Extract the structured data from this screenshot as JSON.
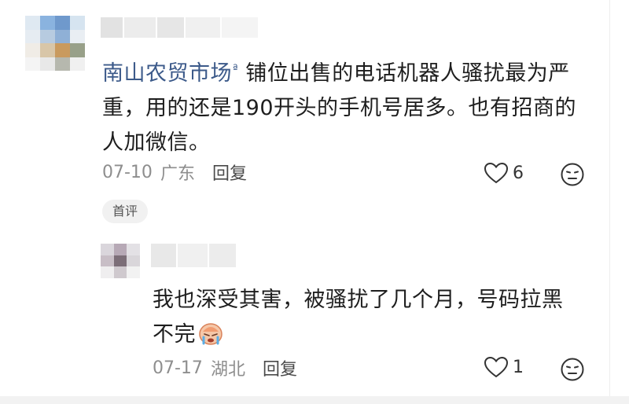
{
  "comments": [
    {
      "mention": "南山农贸市场",
      "mention_mark": "ª",
      "text_line1": " 铺位出售的电话机器人骚扰最为",
      "text_rest": "严重，用的还是190开头的手机号居多。也有招商的人加微信。",
      "date": "07-10",
      "location": "广东",
      "reply_label": "回复",
      "likes": "6",
      "badge": "首评",
      "avatar_mosaic": [
        "#dfe9f2",
        "#8ab3df",
        "#6f99cc",
        "#d6e4f0",
        "#e6ecf2",
        "#b7cbe0",
        "#8fb0d6",
        "#e9eef3",
        "#f0ece6",
        "#d8c6a8",
        "#c99a5e",
        "#98a089",
        "#f4f4f4",
        "#e8e8e8",
        "#b6b8ae",
        "#f0f0f0"
      ]
    },
    {
      "text_line1": "我也深受其害，被骚扰了几个月，号码拉黑",
      "text_line2": "不完",
      "sticker_icon": "crying-face-sticker",
      "date": "07-17",
      "location": "湖北",
      "reply_label": "回复",
      "likes": "1",
      "avatar_mosaic": [
        "#dad6dc",
        "#b7a9b6",
        "#e3e1e5",
        "#c8bec6",
        "#7c6e78",
        "#d9d6da",
        "#efeeef",
        "#cfc9ce",
        "#f2f2f2"
      ]
    }
  ]
}
